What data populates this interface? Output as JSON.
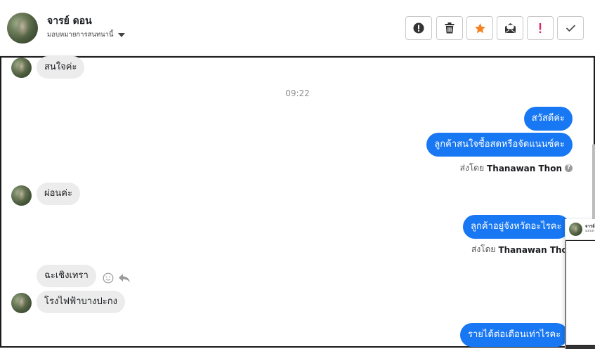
{
  "header": {
    "contact_name": "จารย์ ดอน",
    "contact_subtitle": "มอบหมายการสนทนานี้",
    "avatar_icon": "profile-photo",
    "toolbar": [
      {
        "name": "mark-spam-button",
        "icon": "exclamation-circle-icon"
      },
      {
        "name": "delete-button",
        "icon": "trash-icon"
      },
      {
        "name": "star-button",
        "icon": "star-icon",
        "color": "#f5821f"
      },
      {
        "name": "mark-unread-button",
        "icon": "envelope-icon"
      },
      {
        "name": "flag-important-button",
        "icon": "exclamation-icon",
        "color": "#e0245e"
      },
      {
        "name": "mark-done-button",
        "icon": "check-icon"
      }
    ]
  },
  "messages": {
    "in_1": "สนใจค่ะ",
    "timestamp": "09:22",
    "out_1": "สวัสดีค่ะ",
    "out_2": "ลูกค้าสนใจซื้อสดหรือจัดแนนซ์คะ",
    "sent_by_label": "ส่งโดย",
    "sent_by_name": "Thanawan Thon",
    "in_2": "ผ่อนค่ะ",
    "out_3": "ลูกค้าอยู่จังหวัดอะไรคะ",
    "in_3": "ฉะเชิงเทรา",
    "in_4": "โรงไฟฟ้าบางปะกง",
    "out_4": "รายได้ต่อเดือนเท่าไรคะ"
  },
  "popup": {
    "name": "จารย์",
    "subtitle": "มอบห"
  },
  "colors": {
    "outgoing_bubble": "#1877f2",
    "incoming_bubble": "#ececec"
  }
}
